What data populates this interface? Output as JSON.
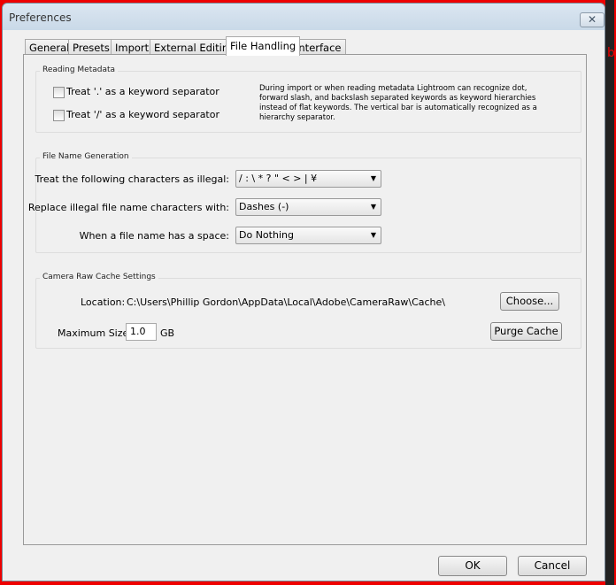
{
  "window": {
    "title": "Preferences",
    "close_icon": "close-icon"
  },
  "tabs": [
    {
      "label": "General",
      "active": false
    },
    {
      "label": "Presets",
      "active": false
    },
    {
      "label": "Import",
      "active": false
    },
    {
      "label": "External Editing",
      "active": false
    },
    {
      "label": "File Handling",
      "active": true
    },
    {
      "label": "Interface",
      "active": false
    }
  ],
  "reading_metadata": {
    "title": "Reading Metadata",
    "options": [
      {
        "label": "Treat '.' as a keyword separator",
        "checked": false
      },
      {
        "label": "Treat '/' as a keyword separator",
        "checked": false
      }
    ],
    "description": "During import or when reading metadata Lightroom can recognize dot, forward slash, and backslash separated keywords as keyword hierarchies instead of flat keywords. The vertical bar is automatically recognized as a hierarchy separator."
  },
  "file_name_generation": {
    "title": "File Name Generation",
    "rows": [
      {
        "label": "Treat the following characters as illegal:",
        "value": "/ : \\ * ? \" < > | ¥"
      },
      {
        "label": "Replace illegal file name characters with:",
        "value": "Dashes (-)"
      },
      {
        "label": "When a file name has a space:",
        "value": "Do Nothing"
      }
    ]
  },
  "camera_raw_cache": {
    "title": "Camera Raw Cache Settings",
    "location_label": "Location:",
    "location_value": "C:\\Users\\Phillip Gordon\\AppData\\Local\\Adobe\\CameraRaw\\Cache\\",
    "choose_label": "Choose...",
    "max_size_label": "Maximum Size:",
    "max_size_value": "1.0",
    "max_size_unit": "GB",
    "purge_label": "Purge Cache"
  },
  "footer": {
    "ok_label": "OK",
    "cancel_label": "Cancel"
  },
  "background": {
    "side_letter": "b"
  }
}
